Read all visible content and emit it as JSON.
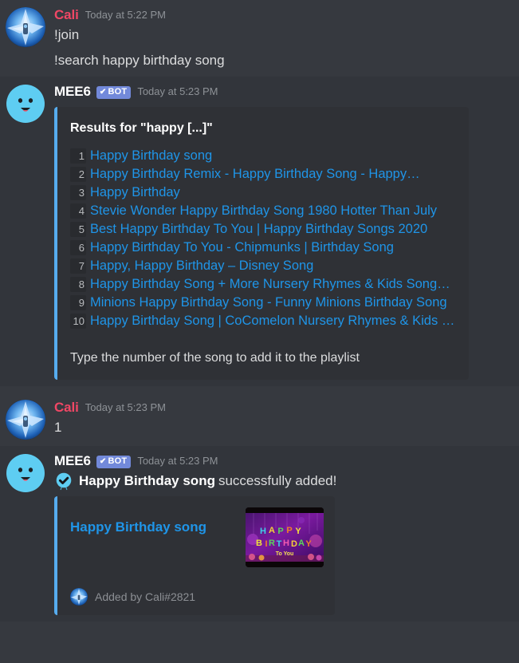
{
  "theme": {
    "app_background": "#36393f",
    "bot_message_background": "#32353b",
    "embed_background": "#2f3136",
    "embed_accent": "#56acee",
    "link_color": "#1f95e8",
    "bot_tag_color": "#7289da",
    "username_color_cali": "#f04765",
    "username_color_mee6": "#ffffff",
    "muted_text": "#8e9297"
  },
  "messages": [
    {
      "id": "msg-cali-commands",
      "author": "Cali",
      "timestamp": "Today at 5:22 PM",
      "is_bot": false,
      "lines": [
        "!join",
        "!search happy birthday song"
      ]
    },
    {
      "id": "msg-mee6-results",
      "author": "MEE6",
      "bot_tag": "BOT",
      "bot_tag_check": "✔",
      "timestamp": "Today at 5:23 PM",
      "is_bot": true,
      "embed": {
        "title": "Results for \"happy [...]\"",
        "results": [
          {
            "number": "1",
            "title": "Happy Birthday song"
          },
          {
            "number": "2",
            "title": "Happy Birthday Remix - Happy Birthday Song - Happy…"
          },
          {
            "number": "3",
            "title": "Happy Birthday"
          },
          {
            "number": "4",
            "title": "Stevie Wonder Happy Birthday Song 1980 Hotter Than July"
          },
          {
            "number": "5",
            "title": "Best Happy Birthday To You | Happy Birthday Songs 2020"
          },
          {
            "number": "6",
            "title": "Happy Birthday To You - Chipmunks | Birthday Song"
          },
          {
            "number": "7",
            "title": "Happy, Happy Birthday – Disney Song"
          },
          {
            "number": "8",
            "title": "Happy Birthday Song + More Nursery Rhymes & Kids Songs -…"
          },
          {
            "number": "9",
            "title": "Minions Happy Birthday Song - Funny Minions Birthday Song"
          },
          {
            "number": "10",
            "title": "Happy Birthday Song | CoComelon Nursery Rhymes & Kids Songs"
          }
        ],
        "footer_note": "Type the number of the song to add it to the playlist"
      }
    },
    {
      "id": "msg-cali-selection",
      "author": "Cali",
      "timestamp": "Today at 5:23 PM",
      "is_bot": false,
      "lines": [
        "1"
      ]
    },
    {
      "id": "msg-mee6-added",
      "author": "MEE6",
      "bot_tag": "BOT",
      "bot_tag_check": "✔",
      "timestamp": "Today at 5:23 PM",
      "is_bot": true,
      "success": {
        "emoji_name": "check-balloon-emoji",
        "song_name": "Happy Birthday song",
        "suffix": "successfully added!"
      },
      "embed": {
        "title": "Happy Birthday song",
        "thumbnail_alt": "HAPPY BIRTHDAY To You balloon letters",
        "thumbnail_text_line1": "HAPPY",
        "thumbnail_text_line2": "BIRTHDAY",
        "thumbnail_text_line3": "To You",
        "footer_text": "Added by Cali#2821"
      }
    }
  ]
}
